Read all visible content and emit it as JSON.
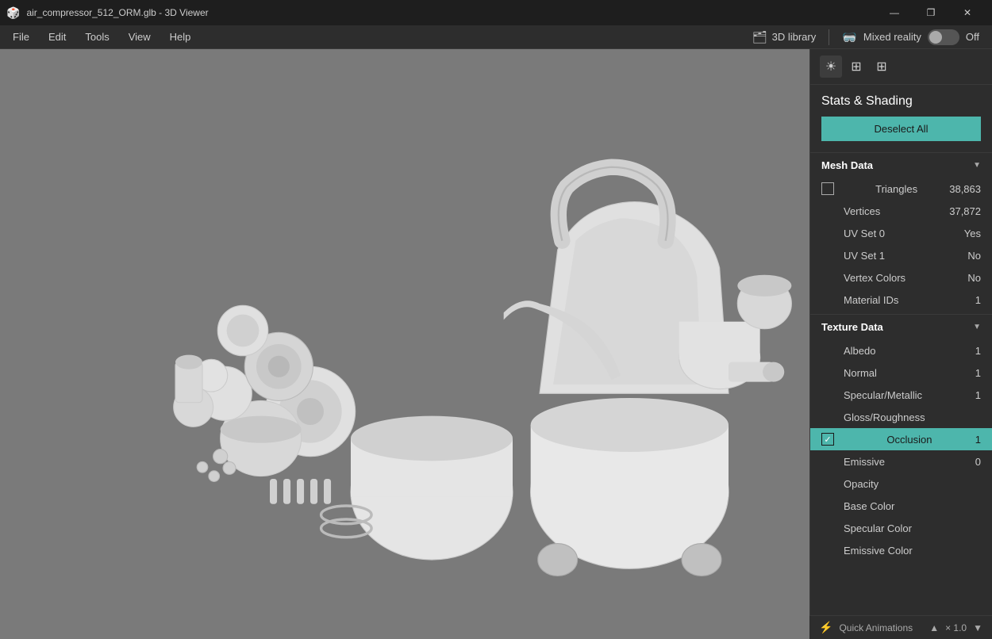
{
  "titlebar": {
    "title": "air_compressor_512_ORM.glb - 3D Viewer",
    "min_btn": "—",
    "restore_btn": "❐",
    "close_btn": "✕"
  },
  "menubar": {
    "items": [
      "File",
      "Edit",
      "Tools",
      "View",
      "Help"
    ],
    "library_btn": "3D library",
    "mixed_reality_label": "Mixed reality",
    "mixed_reality_state": "Off"
  },
  "panel_toolbar": {
    "icons": [
      "☀",
      "▦",
      "▦"
    ]
  },
  "stats_shading": {
    "title": "Stats & Shading",
    "deselect_btn": "Deselect All"
  },
  "mesh_data": {
    "title": "Mesh Data",
    "rows": [
      {
        "label": "Triangles",
        "value": "38,863",
        "has_checkbox": true,
        "checked": false,
        "highlighted": false
      },
      {
        "label": "Vertices",
        "value": "37,872",
        "has_checkbox": false,
        "highlighted": false
      },
      {
        "label": "UV Set 0",
        "value": "Yes",
        "has_checkbox": false,
        "highlighted": false
      },
      {
        "label": "UV Set 1",
        "value": "No",
        "has_checkbox": false,
        "highlighted": false
      },
      {
        "label": "Vertex Colors",
        "value": "No",
        "has_checkbox": false,
        "highlighted": false
      },
      {
        "label": "Material IDs",
        "value": "1",
        "has_checkbox": false,
        "highlighted": false
      }
    ]
  },
  "texture_data": {
    "title": "Texture Data",
    "rows": [
      {
        "label": "Albedo",
        "value": "1",
        "has_checkbox": false,
        "highlighted": false
      },
      {
        "label": "Normal",
        "value": "1",
        "has_checkbox": false,
        "highlighted": false
      },
      {
        "label": "Specular/Metallic",
        "value": "1",
        "has_checkbox": false,
        "highlighted": false
      },
      {
        "label": "Gloss/Roughness",
        "value": "",
        "has_checkbox": false,
        "highlighted": false
      },
      {
        "label": "Occlusion",
        "value": "1",
        "has_checkbox": true,
        "checked": true,
        "highlighted": true
      },
      {
        "label": "Emissive",
        "value": "0",
        "has_checkbox": false,
        "highlighted": false
      },
      {
        "label": "Opacity",
        "value": "",
        "has_checkbox": false,
        "highlighted": false
      },
      {
        "label": "Base Color",
        "value": "",
        "has_checkbox": false,
        "highlighted": false
      },
      {
        "label": "Specular Color",
        "value": "",
        "has_checkbox": false,
        "highlighted": false
      },
      {
        "label": "Emissive Color",
        "value": "",
        "has_checkbox": false,
        "highlighted": false
      }
    ]
  },
  "bottom_bar": {
    "icon": "⚡",
    "label": "Quick Animations",
    "zoom": "× 1.0"
  }
}
